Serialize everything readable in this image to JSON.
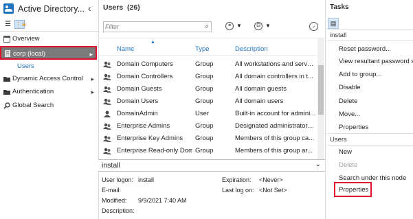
{
  "app": {
    "title": "Active Directory..."
  },
  "nav": {
    "overview": "Overview",
    "corp": "corp (local)",
    "users": "Users",
    "dac": "Dynamic Access Control",
    "auth": "Authentication",
    "global_search": "Global Search"
  },
  "list": {
    "header_title": "Users",
    "header_count": "(26)",
    "filter_placeholder": "Filter",
    "columns": [
      "Name",
      "Type",
      "Description"
    ],
    "rows": [
      {
        "name": "Domain Computers",
        "type": "Group",
        "desc": "All workstations and serve..."
      },
      {
        "name": "Domain Controllers",
        "type": "Group",
        "desc": "All domain controllers in t..."
      },
      {
        "name": "Domain Guests",
        "type": "Group",
        "desc": "All domain guests"
      },
      {
        "name": "Domain Users",
        "type": "Group",
        "desc": "All domain users"
      },
      {
        "name": "DomainAdmin",
        "type": "User",
        "desc": "Built-in account for admini..."
      },
      {
        "name": "Enterprise Admins",
        "type": "Group",
        "desc": "Designated administrators..."
      },
      {
        "name": "Enterprise Key Admins",
        "type": "Group",
        "desc": "Members of this group ca..."
      },
      {
        "name": "Enterprise Read-only Dom...",
        "type": "Group",
        "desc": "Members of this group ar..."
      }
    ]
  },
  "detail": {
    "name": "install",
    "user_logon_label": "User logon:",
    "user_logon_value": "install",
    "email_label": "E-mail:",
    "modified_label": "Modified:",
    "modified_value": "9/9/2021 7:40 AM",
    "description_label": "Description:",
    "expiration_label": "Expiration:",
    "expiration_value": "<Never>",
    "lastlogon_label": "Last log on:",
    "lastlogon_value": "<Not Set>"
  },
  "tasks": {
    "title": "Tasks",
    "section1": "install",
    "items1": [
      "Reset password...",
      "View resultant password setti",
      "Add to group...",
      "Disable",
      "Delete",
      "Move...",
      "Properties"
    ],
    "section2": "Users",
    "items2": [
      "New",
      "Delete",
      "Search under this node",
      "Properties"
    ]
  },
  "colors": {
    "accent": "#1e73be",
    "highlight_border": "#e0102a",
    "selected_bg": "#7a7a7a"
  }
}
